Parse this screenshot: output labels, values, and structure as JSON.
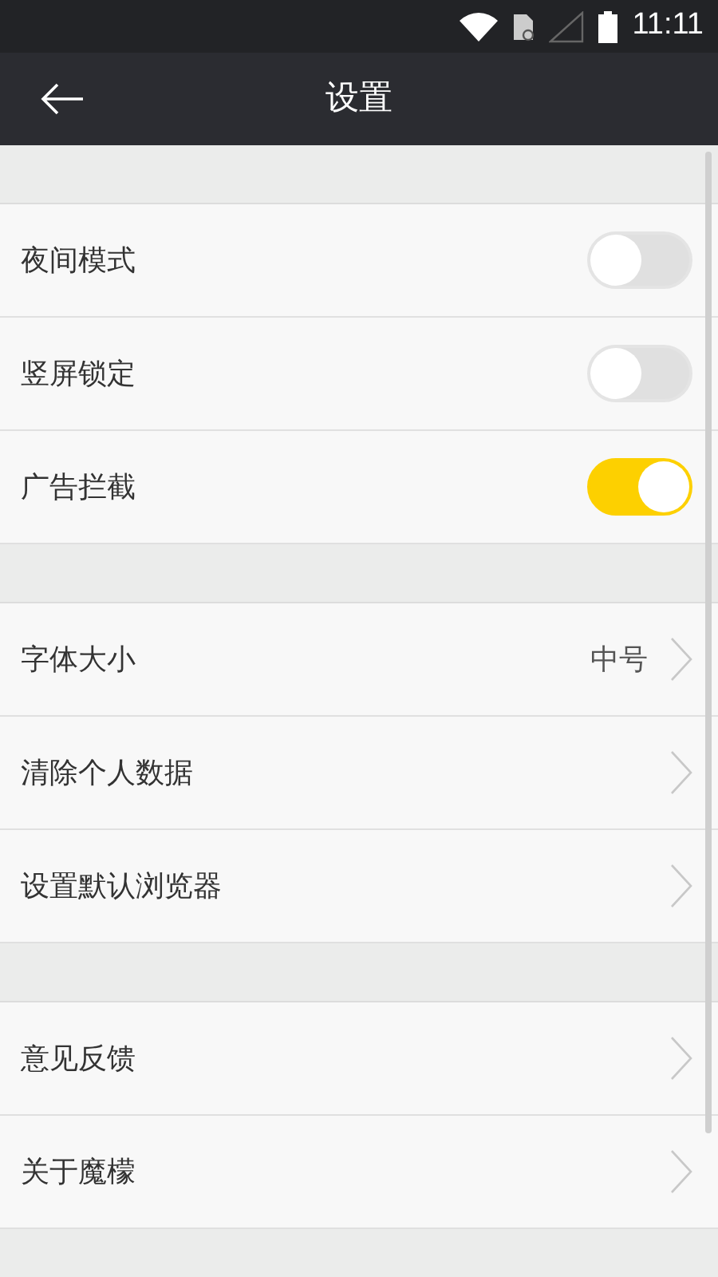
{
  "status_bar": {
    "time": "11:11"
  },
  "app_bar": {
    "title": "设置"
  },
  "groups": [
    {
      "items": [
        {
          "kind": "toggle",
          "label": "夜间模式",
          "on": false
        },
        {
          "kind": "toggle",
          "label": "竖屏锁定",
          "on": false
        },
        {
          "kind": "toggle",
          "label": "广告拦截",
          "on": true
        }
      ]
    },
    {
      "items": [
        {
          "kind": "link",
          "label": "字体大小",
          "value": "中号"
        },
        {
          "kind": "link",
          "label": "清除个人数据"
        },
        {
          "kind": "link",
          "label": "设置默认浏览器"
        }
      ]
    },
    {
      "items": [
        {
          "kind": "link",
          "label": "意见反馈"
        },
        {
          "kind": "link",
          "label": "关于魔檬"
        }
      ]
    }
  ]
}
